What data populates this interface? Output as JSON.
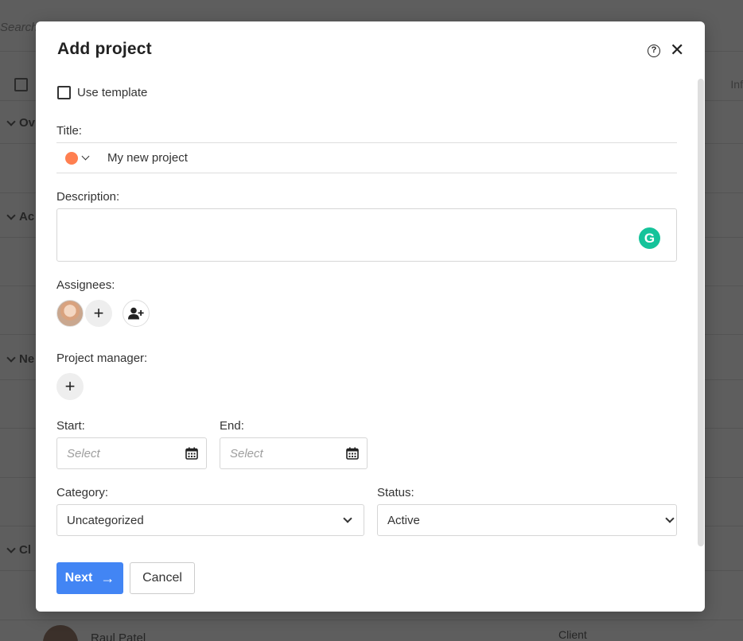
{
  "background": {
    "search_placeholder": "Search",
    "info_header": "Inf",
    "group_labels": [
      "Ov",
      "Ac",
      "Ne",
      "Cl"
    ],
    "person_name": "Raul Patel",
    "person_role": "Client"
  },
  "modal": {
    "title": "Add project",
    "help_icon": "?",
    "close_icon": "✕",
    "use_template_label": "Use template",
    "title_label": "Title:",
    "title_value": "My new project",
    "project_color": "#ff7f50",
    "description_label": "Description:",
    "grammarly_icon": "G",
    "assignees_label": "Assignees:",
    "add_assignee_icon": "+",
    "project_manager_label": "Project manager:",
    "add_manager_icon": "+",
    "start_label": "Start:",
    "start_placeholder": "Select",
    "end_label": "End:",
    "end_placeholder": "Select",
    "category_label": "Category:",
    "category_value": "Uncategorized",
    "status_label": "Status:",
    "status_value": "Active",
    "next_label": "Next",
    "next_arrow": "→",
    "cancel_label": "Cancel"
  },
  "colors": {
    "primary_button": "#4285f4",
    "grammarly": "#15c39a",
    "overlay": "#5e5e5e"
  }
}
